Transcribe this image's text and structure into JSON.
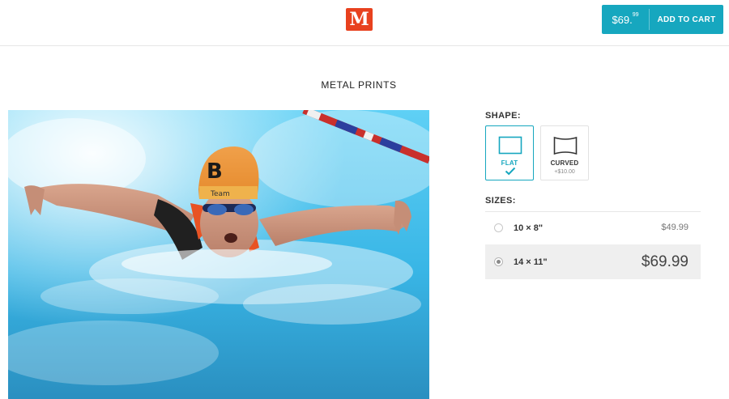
{
  "header": {
    "logo_letter": "M",
    "cart": {
      "price_main": "$69.",
      "price_cents": "99",
      "add_label": "ADD TO CART"
    }
  },
  "page_title": "METAL PRINTS",
  "product_image": {
    "team_text": "Team",
    "cap_letter": "B"
  },
  "shape": {
    "label": "SHAPE:",
    "options": [
      {
        "name": "FLAT",
        "selected": true
      },
      {
        "name": "CURVED",
        "price": "+$10.00",
        "selected": false
      }
    ]
  },
  "sizes": {
    "label": "SIZES:",
    "options": [
      {
        "name": "10 × 8\"",
        "price": "$49.99",
        "selected": false
      },
      {
        "name": "14 × 11\"",
        "price": "$69.99",
        "selected": true
      }
    ]
  },
  "colors": {
    "accent": "#16a7bf",
    "logo": "#e8411e"
  }
}
